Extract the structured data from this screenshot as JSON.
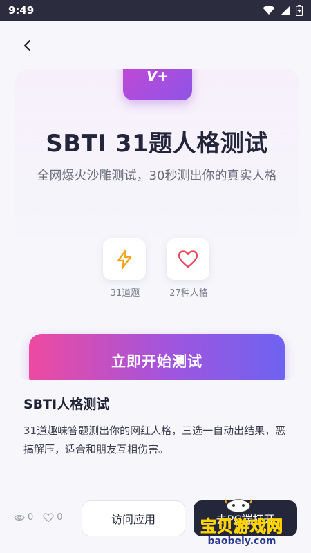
{
  "status_bar": {
    "time": "9:49"
  },
  "hero": {
    "badge_text": "V+",
    "title": "SBTI 31题人格测试",
    "subtitle": "全网爆火沙雕测试，30秒测出你的真实人格",
    "features": [
      {
        "icon": "lightning-icon",
        "label": "31道题"
      },
      {
        "icon": "heart-icon",
        "label": "27种人格"
      }
    ],
    "start_button": "立即开始测试"
  },
  "app": {
    "name": "SBTI人格测试",
    "description": "31道趣味答题测出你的网红人格，三选一自动出结果，恶搞解压，适合和朋友互相伤害。"
  },
  "stats": {
    "views": "0",
    "likes": "0"
  },
  "actions": {
    "visit_label": "访问应用",
    "dark_label": "去PC端打开"
  },
  "watermark": {
    "brand": "宝贝游戏网",
    "url": "baobeiy.com"
  },
  "colors": {
    "accent_pink": "#ee4aa0",
    "accent_purple": "#8e54e6",
    "accent_blue": "#6e63f0",
    "status_bar": "#2b2d3f"
  }
}
